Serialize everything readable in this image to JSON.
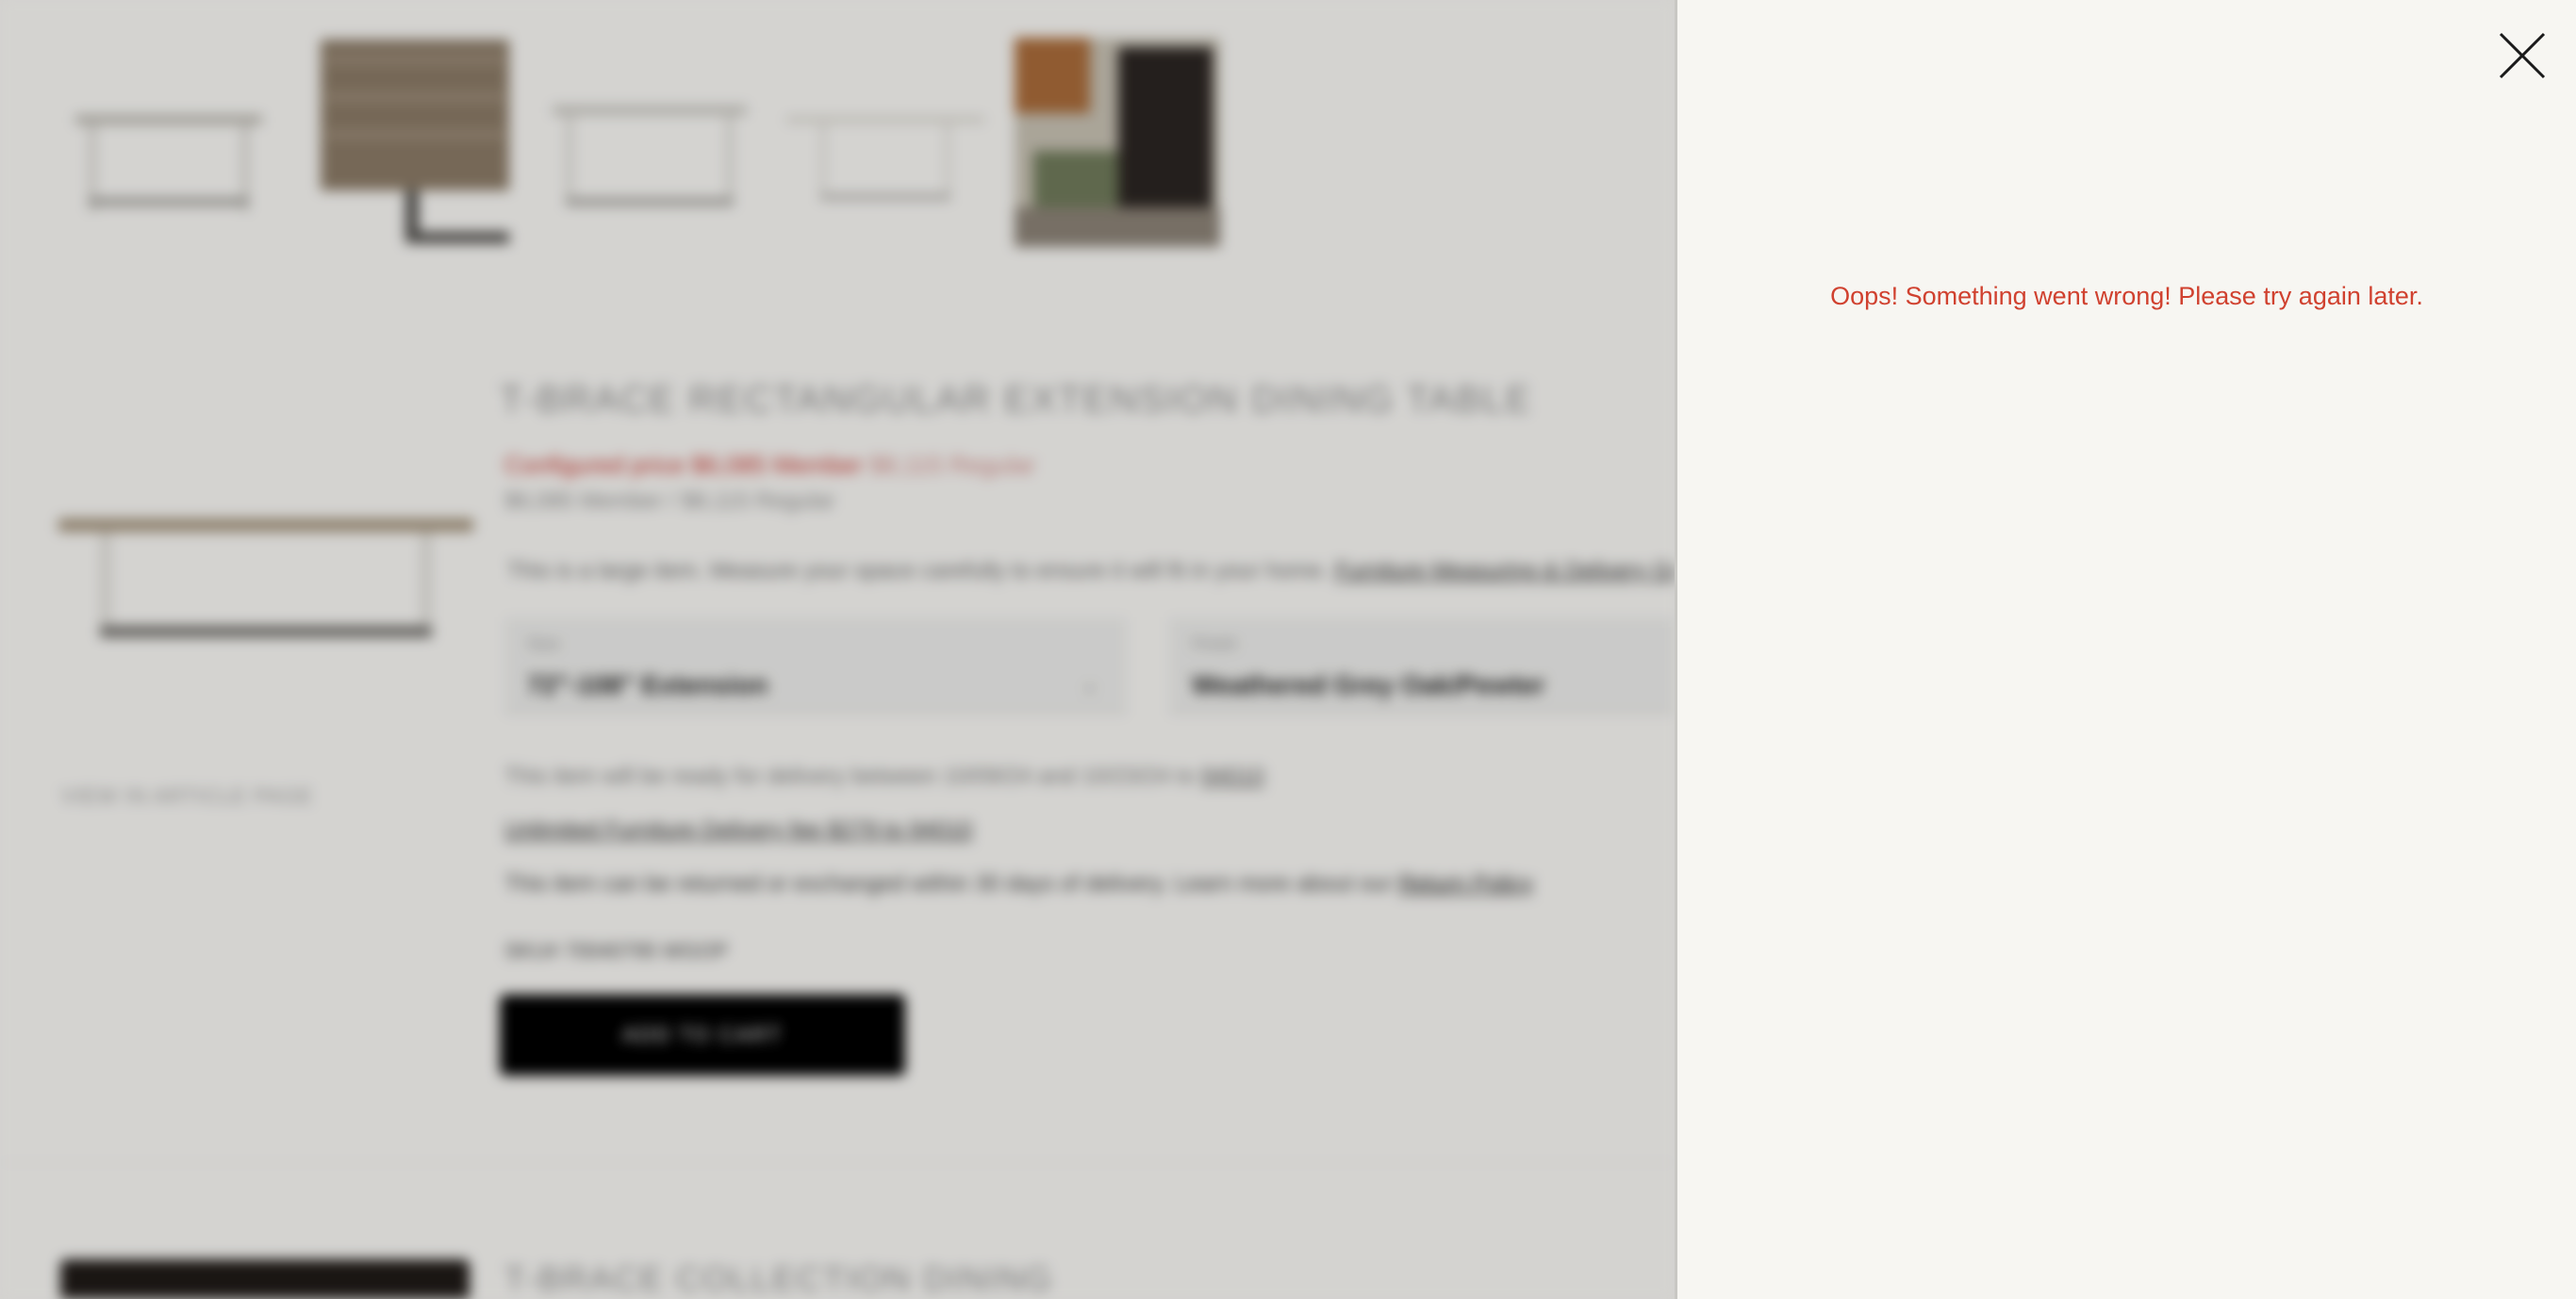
{
  "background": {
    "product": {
      "title": "T-BRACE RECTANGULAR EXTENSION DINING TABLE",
      "member_price": "Configured price $6,085 Member",
      "regular_price": "$8,115 Regular",
      "sale_price": "$6,085 Member / $8,115 Regular",
      "sizing_note": "This is a large item. Measure your space carefully to ensure it will fit in your home.",
      "sizing_link": "Furniture Measuring & Delivery Guide",
      "size_label": "Size",
      "size_value": "72\"-108\" Extension",
      "finish_label": "Finish",
      "finish_value": "Weathered Grey Oak/Pewter",
      "delivery_note": "This item will be ready for delivery between 10/09/24 and 10/23/24 to",
      "delivery_zip": "94010",
      "estimate_link": "Unlimited Furniture Delivery fee $279 to 94010",
      "returns_note": "This item can be returned or exchanged within 30 days of delivery. Learn more about our",
      "returns_link": "Return Policy",
      "sku": "SKU# 70040795 WGOP",
      "cart_button_label": "ADD TO CART"
    },
    "collection_label": "VIEW IN ARTICLE PAGE",
    "collection_title": "T-BRACE COLLECTION DINING"
  },
  "drawer": {
    "error_message": "Oops! Something went wrong! Please try again later.",
    "close_icon": "close-icon"
  },
  "colors": {
    "error": "#d0412f",
    "drawer_bg": "#f7f6f2",
    "button_bg": "#000000"
  }
}
